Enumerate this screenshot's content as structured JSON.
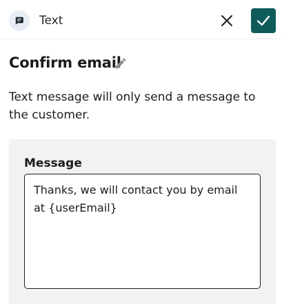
{
  "header": {
    "type_icon": "message-bubble-icon",
    "type_label": "Text",
    "close_icon": "close-icon",
    "confirm_icon": "checkmark-icon",
    "confirm_color": "#0f5b5c"
  },
  "title": {
    "text": "Confirm email",
    "edit_icon": "pencil-icon"
  },
  "description": "Text message will only send a message to the customer.",
  "message": {
    "label": "Message",
    "value": "Thanks, we will contact you by email at {userEmail}"
  }
}
